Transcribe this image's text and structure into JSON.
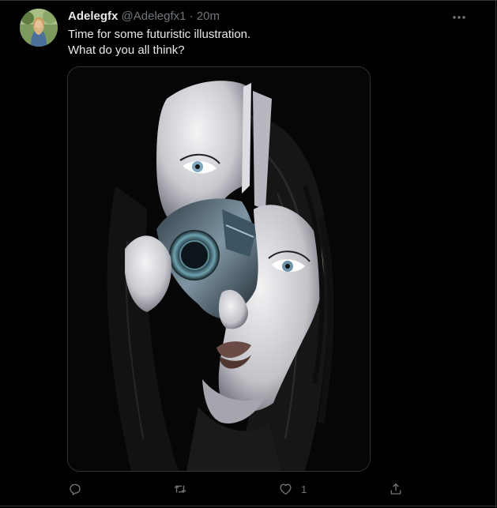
{
  "tweet": {
    "author": {
      "display_name": "Adelegfx",
      "handle": "@Adelegfx1"
    },
    "separator": "·",
    "time": "20m",
    "text_lines": [
      "Time for some futuristic illustration.",
      "What do you all think?"
    ],
    "media": {
      "subject": "half-human half-robot woman illustration"
    },
    "actions": {
      "reply": {
        "icon": "reply-icon"
      },
      "retweet": {
        "icon": "retweet-icon"
      },
      "like": {
        "icon": "heart-icon",
        "count": "1"
      },
      "share": {
        "icon": "share-icon"
      }
    }
  },
  "colors": {
    "background": "#000000",
    "text": "#e7e9ea",
    "secondary_text": "#71767b",
    "border": "#2f3336"
  }
}
